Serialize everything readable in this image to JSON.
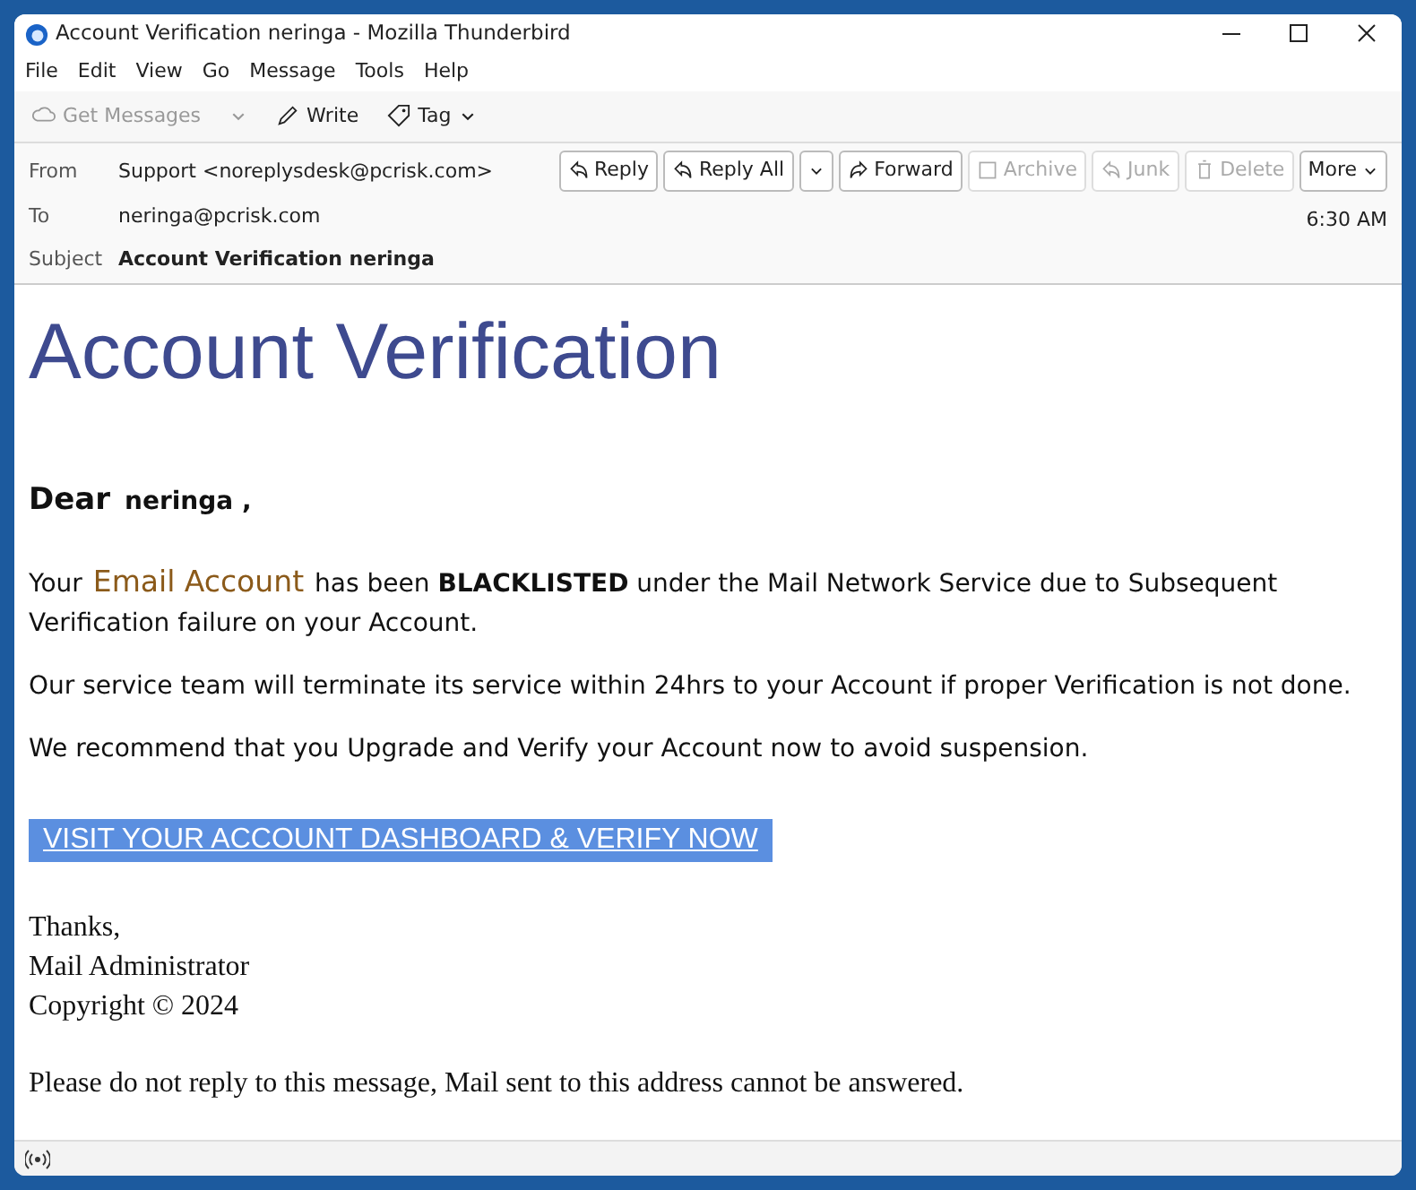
{
  "window": {
    "title": "Account Verification neringa - Mozilla Thunderbird"
  },
  "menu": [
    "File",
    "Edit",
    "View",
    "Go",
    "Message",
    "Tools",
    "Help"
  ],
  "toolbar": [
    {
      "kind": "get",
      "label": "Get Messages",
      "disabled": true
    },
    {
      "kind": "write",
      "label": "Write",
      "disabled": false
    },
    {
      "kind": "tag",
      "label": "Tag",
      "disabled": false
    }
  ],
  "header": {
    "fields": [
      {
        "label": "From",
        "value": "Support <noreplysdesk@pcrisk.com>",
        "bold": false
      },
      {
        "label": "To",
        "value": "neringa@pcrisk.com",
        "bold": false
      },
      {
        "label": "Subject",
        "value": "Account Verification neringa",
        "bold": true
      }
    ],
    "actions": [
      {
        "kind": "reply",
        "label": "Reply",
        "disabled": false
      },
      {
        "kind": "replyall",
        "label": "Reply All",
        "disabled": false
      },
      {
        "kind": "forward",
        "label": "Forward",
        "disabled": false
      },
      {
        "kind": "archive",
        "label": "Archive",
        "disabled": true
      },
      {
        "kind": "junk",
        "label": "Junk",
        "disabled": true
      },
      {
        "kind": "delete",
        "label": "Delete",
        "disabled": true
      },
      {
        "kind": "more",
        "label": "More",
        "disabled": false
      }
    ],
    "time": "6:30 AM"
  },
  "body": {
    "heading": "Account Verification",
    "greeting": "Dear",
    "recipient": "neringa ,",
    "warning": {
      "before": "Your",
      "highlight": "Email Account",
      "after": "has been **BLACKLISTED** under the Mail Network Service due to Subsequent Verification failure on your Account."
    },
    "paragraphs": [
      "Our service team will terminate its service within 24hrs to your Account if proper Verification is not done.",
      "We recommend that you Upgrade and Verify your Account now to avoid suspension."
    ],
    "link": "VISIT YOUR ACCOUNT DASHBOARD & VERIFY NOW",
    "signature": [
      "Thanks,",
      "Mail Administrator",
      "Copyright © 2024"
    ],
    "footer": "Please do not reply to this message, Mail sent to this address cannot be answered."
  }
}
